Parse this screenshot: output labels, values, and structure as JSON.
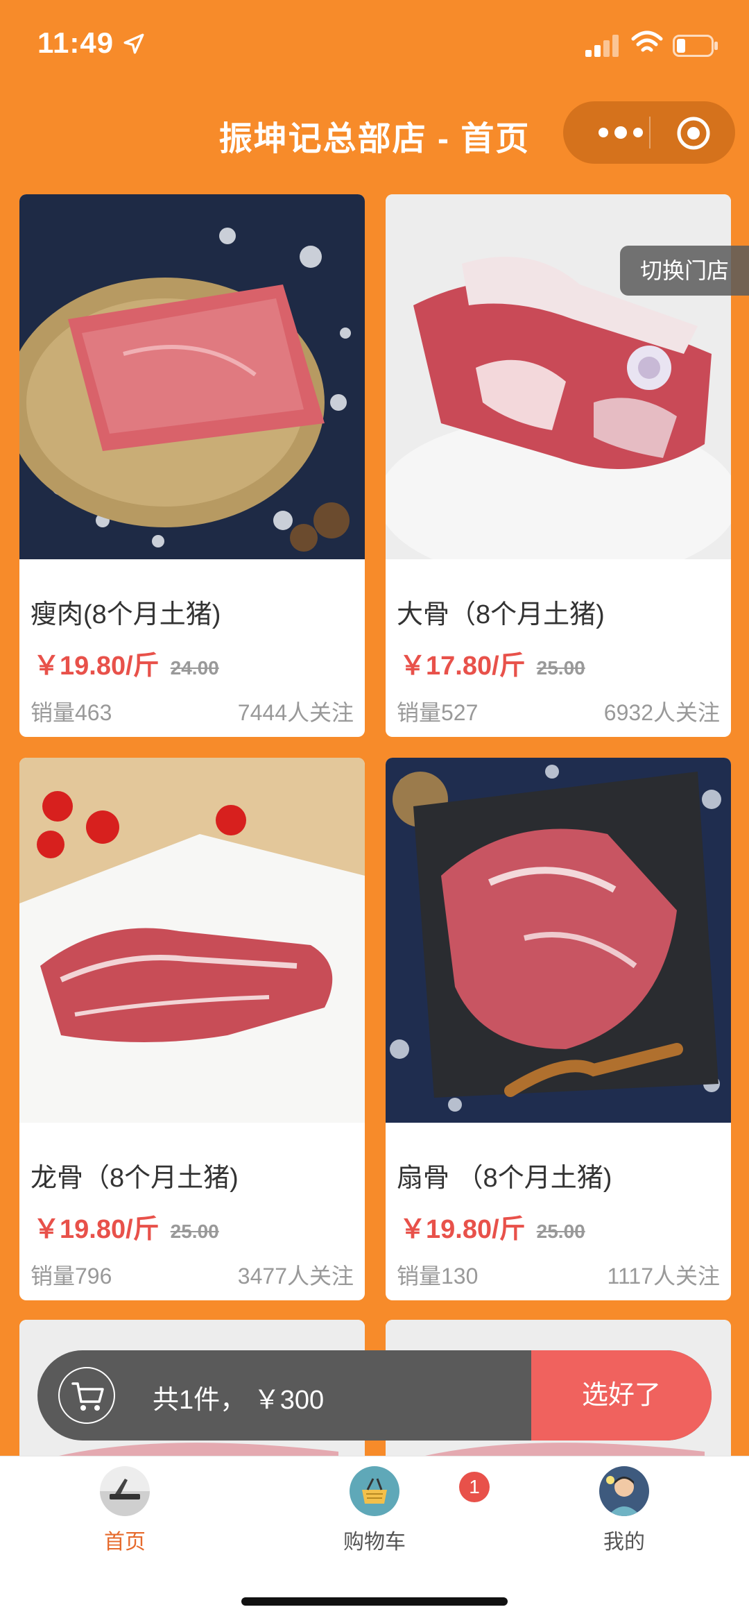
{
  "status_bar": {
    "time": "11:49"
  },
  "nav": {
    "title": "振坤记总部店 - 首页"
  },
  "switch_store_label": "切换门店",
  "products": [
    {
      "name": "瘦肉(8个月土猪)",
      "price": "￥19.80/斤",
      "old_price": "24.00",
      "sales": "销量463",
      "followers": "7444人关注"
    },
    {
      "name": "大骨（8个月土猪)",
      "price": "￥17.80/斤",
      "old_price": "25.00",
      "sales": "销量527",
      "followers": "6932人关注"
    },
    {
      "name": "龙骨（8个月土猪)",
      "price": "￥19.80/斤",
      "old_price": "25.00",
      "sales": "销量796",
      "followers": "3477人关注"
    },
    {
      "name": "扇骨 （8个月土猪)",
      "price": "￥19.80/斤",
      "old_price": "25.00",
      "sales": "销量130",
      "followers": "1117人关注"
    }
  ],
  "cart": {
    "summary": "共1件， ￥300",
    "checkout_label": "选好了"
  },
  "tabs": [
    {
      "label": "首页",
      "active": true
    },
    {
      "label": "购物车",
      "badge": "1"
    },
    {
      "label": "我的"
    }
  ],
  "colors": {
    "brand_orange": "#F78B2A",
    "price_red": "#E8514A",
    "checkout_red": "#F0625E",
    "tab_active": "#E66A2C"
  }
}
